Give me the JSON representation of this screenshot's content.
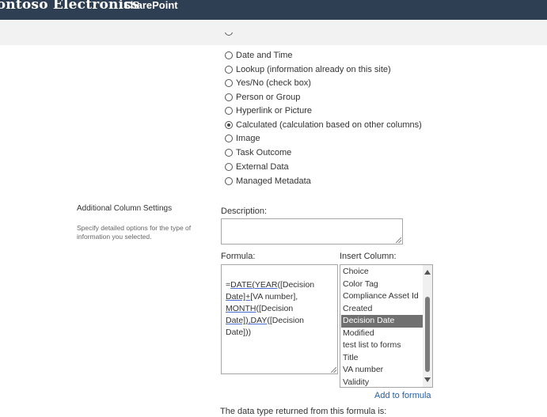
{
  "header": {
    "brand": "Contoso Electronics",
    "app_name": "SharePoint"
  },
  "column_types": [
    {
      "label": "Date and Time",
      "checked": false
    },
    {
      "label": "Lookup (information already on this site)",
      "checked": false
    },
    {
      "label": "Yes/No (check box)",
      "checked": false
    },
    {
      "label": "Person or Group",
      "checked": false
    },
    {
      "label": "Hyperlink or Picture",
      "checked": false
    },
    {
      "label": "Calculated (calculation based on other columns)",
      "checked": true
    },
    {
      "label": "Image",
      "checked": false
    },
    {
      "label": "Task Outcome",
      "checked": false
    },
    {
      "label": "External Data",
      "checked": false
    },
    {
      "label": "Managed Metadata",
      "checked": false
    }
  ],
  "additional_settings": {
    "title": "Additional Column Settings",
    "description": "Specify detailed options for the type of information you selected.",
    "description_label": "Description:",
    "description_value": "",
    "formula_label": "Formula:",
    "formula_lines": [
      [
        "=",
        "DATE",
        "(",
        "YEAR",
        "([Decision"
      ],
      [
        "Date]+",
        "[VA number],"
      ],
      [
        "MONTH",
        "([Decision"
      ],
      [
        "Date]),",
        "DAY",
        "([Decision"
      ],
      [
        "Date]))"
      ]
    ],
    "insert_column_label": "Insert Column:",
    "insert_columns": [
      "Choice",
      "Color Tag",
      "Compliance Asset Id",
      "Created",
      "Decision Date",
      "Modified",
      "test list to forms",
      "Title",
      "VA number",
      "Validity"
    ],
    "selected_column": "Decision Date",
    "add_to_formula": "Add to formula",
    "data_type_text": "The data type returned from this formula is:"
  },
  "colors": {
    "header_bg": "#2f3f53",
    "link": "#1e5fa8",
    "selection": "#707070"
  }
}
